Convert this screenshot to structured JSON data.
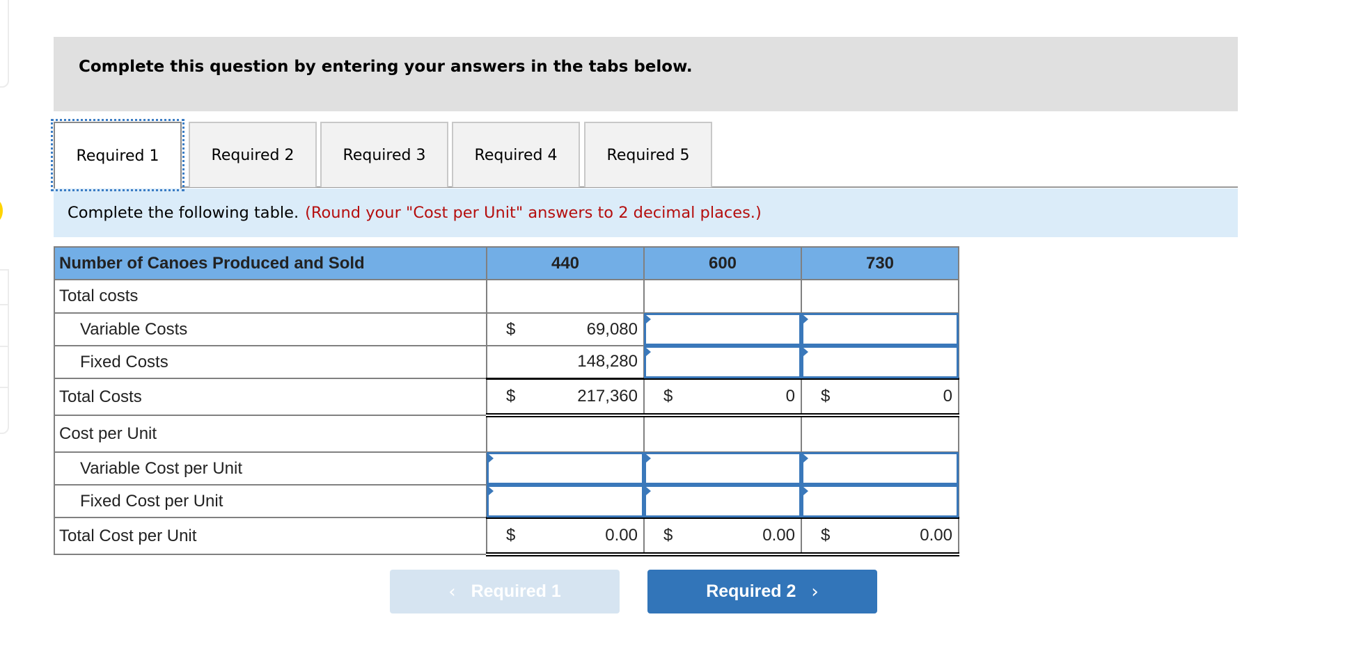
{
  "instruction": "Complete this question by entering your answers in the tabs below.",
  "tabs": [
    {
      "label": "Required 1",
      "active": true
    },
    {
      "label": "Required 2",
      "active": false
    },
    {
      "label": "Required 3",
      "active": false
    },
    {
      "label": "Required 4",
      "active": false
    },
    {
      "label": "Required 5",
      "active": false
    }
  ],
  "prompt": {
    "text": "Complete the following table.",
    "note": "(Round your \"Cost per Unit\" answers to 2 decimal places.)"
  },
  "colors": {
    "header_bg": "#72aee6",
    "prompt_bg": "#dbecf9",
    "note_red": "#b50e0e",
    "input_border": "#3a78ba",
    "next_button": "#3275b9",
    "prev_button_disabled": "#d6e4f1"
  },
  "table": {
    "header": {
      "label": "Number of Canoes Produced and Sold",
      "quantities": [
        "440",
        "600",
        "730"
      ]
    },
    "rows": {
      "total_costs_heading": {
        "label": "Total costs"
      },
      "variable_costs": {
        "label": "Variable Costs",
        "cells": [
          {
            "currency": "$",
            "value": "69,080"
          },
          {
            "input": true,
            "value": ""
          },
          {
            "input": true,
            "value": ""
          }
        ]
      },
      "fixed_costs": {
        "label": "Fixed Costs",
        "cells": [
          {
            "currency": "",
            "value": "148,280"
          },
          {
            "input": true,
            "value": ""
          },
          {
            "input": true,
            "value": ""
          }
        ]
      },
      "total_costs": {
        "label": "Total Costs",
        "cells": [
          {
            "currency": "$",
            "value": "217,360"
          },
          {
            "currency": "$",
            "value": "0"
          },
          {
            "currency": "$",
            "value": "0"
          }
        ]
      },
      "cost_per_unit_heading": {
        "label": "Cost per Unit"
      },
      "variable_cost_per_unit": {
        "label": "Variable Cost per Unit",
        "cells": [
          {
            "input": true,
            "value": ""
          },
          {
            "input": true,
            "value": ""
          },
          {
            "input": true,
            "value": ""
          }
        ]
      },
      "fixed_cost_per_unit": {
        "label": "Fixed Cost per Unit",
        "cells": [
          {
            "input": true,
            "value": ""
          },
          {
            "input": true,
            "value": ""
          },
          {
            "input": true,
            "value": ""
          }
        ]
      },
      "total_cost_per_unit": {
        "label": "Total Cost per Unit",
        "cells": [
          {
            "currency": "$",
            "value": "0.00"
          },
          {
            "currency": "$",
            "value": "0.00"
          },
          {
            "currency": "$",
            "value": "0.00"
          }
        ]
      }
    }
  },
  "nav": {
    "prev": {
      "label": "Required 1",
      "icon": "chevron-left",
      "glyph": "‹",
      "enabled": false
    },
    "next": {
      "label": "Required 2",
      "icon": "chevron-right",
      "glyph": "›",
      "enabled": true
    }
  }
}
